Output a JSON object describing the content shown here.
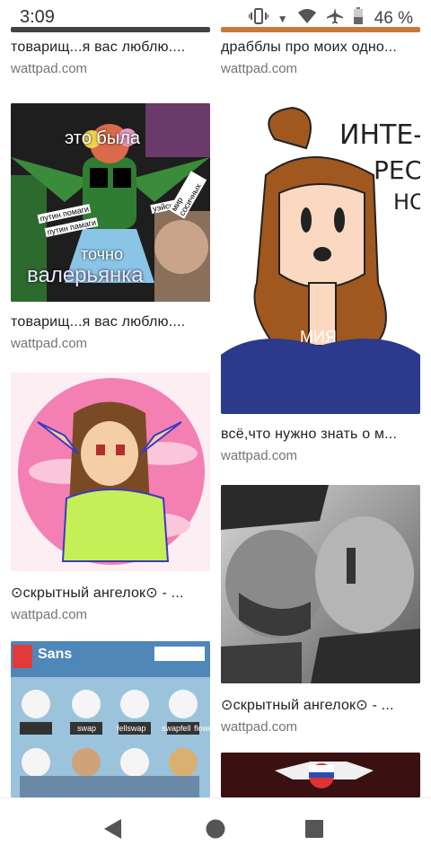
{
  "status_bar": {
    "time": "3:09",
    "battery_percent": "46 %",
    "icons": [
      "vibrate-icon",
      "wifi-icon",
      "airplane-mode-icon",
      "battery-icon"
    ]
  },
  "results": {
    "left": [
      {
        "caption": "товарищ...я вас люблю....",
        "source": "wattpad.com"
      },
      {
        "caption": "товарищ...я вас люблю....",
        "source": "wattpad.com",
        "image_text": [
          "это была",
          "точно",
          "валерьянка",
          "путин помаги",
          "путин памаги",
          "уэйсик",
          "мир сосичных"
        ]
      },
      {
        "caption": "⊙скрытный ангелок⊙ - ...",
        "source": "wattpad.com"
      },
      {
        "caption": "",
        "source": "",
        "image_text": [
          "Sans",
          "swap",
          "fellswap",
          "swapfell",
          "flowe"
        ]
      }
    ],
    "right": [
      {
        "caption": "драбблы про моих одно...",
        "source": "wattpad.com"
      },
      {
        "caption": "всё,что нужно знать о м...",
        "source": "wattpad.com",
        "image_text": [
          "ИНТЕ-",
          "РЕС",
          "НО",
          "МИЯ"
        ]
      },
      {
        "caption": "⊙скрытный ангелок⊙ - ...",
        "source": "wattpad.com"
      }
    ]
  },
  "nav": {
    "back": "back-triangle-icon",
    "home": "home-circle-icon",
    "recents": "recents-square-icon"
  }
}
